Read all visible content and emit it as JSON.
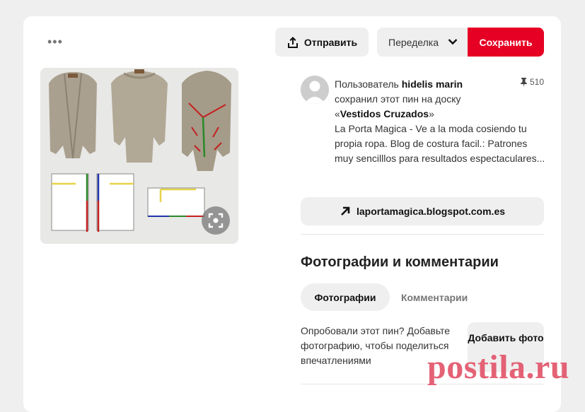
{
  "toolbar": {
    "more_icon": "more-horizontal-icon",
    "send_label": "Отправить",
    "send_icon": "share-upload-icon",
    "board_name": "Переделка",
    "save_label": "Сохранить"
  },
  "pin": {
    "image_label": "cardigan-pattern-photo",
    "user_prefix": "Пользователь",
    "username": "hidelis marin",
    "saved_text": "сохранил этот пин на доску",
    "board_open_quote": "«",
    "board_title": "Vestidos Cruzados",
    "board_close_quote": "»",
    "description": "La Porta Magica - Ve a la moda cosiendo tu propia ropa. Blog de costura facil.: Patrones muy sencilllos para resultados espectaculares...",
    "repin_count": "510",
    "link_text": "laportamagica.blogspot.com.es"
  },
  "photos_comments": {
    "title": "Фотографии и комментарии",
    "tabs": [
      {
        "label": "Фотографии",
        "active": true
      },
      {
        "label": "Комментарии",
        "active": false
      }
    ],
    "prompt": "Опробовали этот пин? Добавьте фотографию, чтобы поделиться впечатлениями",
    "add_photo_label": "Добавить фото"
  },
  "watermark": "postila.ru",
  "colors": {
    "save_red": "#e60023",
    "button_gray": "#efefef",
    "watermark_pink": "#e2556b"
  }
}
